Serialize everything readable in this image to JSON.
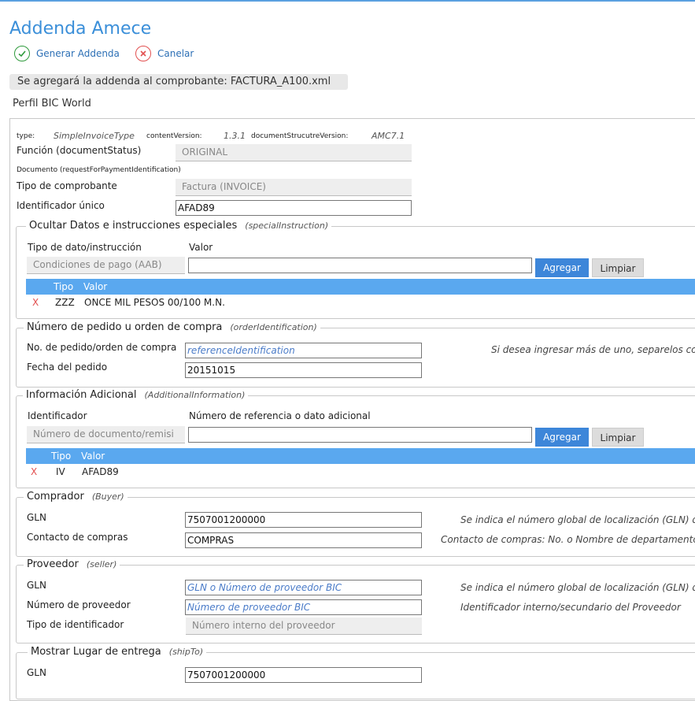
{
  "header": {
    "title": "Addenda Amece",
    "generate_label": "Generar Addenda",
    "cancel_label": "Canelar",
    "banner": "Se agregará la addenda al comprobante: FACTURA_A100.xml",
    "profile": "Perfil BIC World"
  },
  "meta": {
    "type_key": "type:",
    "type_val": "SimpleInvoiceType",
    "content_key": "contentVersion:",
    "content_val": "1.3.1",
    "doc_key": "documentStrucutreVersion:",
    "doc_val": "AMC7.1"
  },
  "general": {
    "funcion_label": "Función (documentStatus)",
    "funcion_value": "ORIGINAL",
    "documento_label": "Documento (requestForPaymentIdentification)",
    "tipo_label": "Tipo de comprobante",
    "tipo_value": "Factura (INVOICE)",
    "id_label": "Identificador único",
    "id_value": "AFAD89"
  },
  "special": {
    "legend": "Ocultar  Datos e instrucciones especiales",
    "legend_en": "(specialInstruction)",
    "col_tipo_label": "Tipo de dato/instrucción",
    "col_valor_label": "Valor",
    "tipo_select": "Condiciones de pago (AAB)",
    "valor_input": "",
    "add_label": "Agregar",
    "clear_label": "Limpiar",
    "table_headers": [
      "Tipo",
      "Valor"
    ],
    "rows": [
      {
        "del": "X",
        "tipo": "ZZZ",
        "valor": "ONCE MIL PESOS 00/100 M.N."
      }
    ]
  },
  "order": {
    "legend": "Número de pedido u orden de compra",
    "legend_en": "(orderIdentification)",
    "pedido_label": "No. de pedido/orden de compra",
    "pedido_placeholder": "referenceIdentification",
    "pedido_hint": "Si desea ingresar más de uno, separelos con",
    "fecha_label": "Fecha del pedido",
    "fecha_value": "20151015"
  },
  "additional": {
    "legend": "Información Adicional",
    "legend_en": "(AdditionalInformation)",
    "col_id_label": "Identificador",
    "col_ref_label": "Número de referencia o dato adicional",
    "id_select": "Número de documento/remisi",
    "ref_input": "",
    "add_label": "Agregar",
    "clear_label": "Limpiar",
    "table_headers": [
      "Tipo",
      "Valor"
    ],
    "rows": [
      {
        "del": "X",
        "tipo": "IV",
        "valor": "AFAD89"
      }
    ]
  },
  "buyer": {
    "legend": "Comprador",
    "legend_en": "(Buyer)",
    "gln_label": "GLN",
    "gln_value": "7507001200000",
    "gln_hint": "Se indica el número global de localización (GLN) de",
    "contact_label": "Contacto de compras",
    "contact_value": "COMPRAS",
    "contact_hint": "Contacto de compras: No. o Nombre de departamento"
  },
  "seller": {
    "legend": "Proveedor",
    "legend_en": "(seller)",
    "gln_label": "GLN",
    "gln_placeholder": "GLN o Número de proveedor BIC",
    "gln_hint": "Se indica el número global de localización (GLN) de",
    "num_label": "Número de proveedor",
    "num_placeholder": "Número de proveedor BIC",
    "num_hint": "Identificador interno/secundario del Proveedor",
    "idtype_label": "Tipo de identificador",
    "idtype_value": "Número interno del proveedor"
  },
  "shipto": {
    "legend": "Mostrar  Lugar de entrega",
    "legend_en": "(shipTo)",
    "gln_label": "GLN",
    "gln_value": "7507001200000"
  },
  "colors": {
    "accent": "#3b8fd9",
    "table_header": "#5aa8ef",
    "delete": "#e25050",
    "ok_green": "#2e9a3c"
  }
}
